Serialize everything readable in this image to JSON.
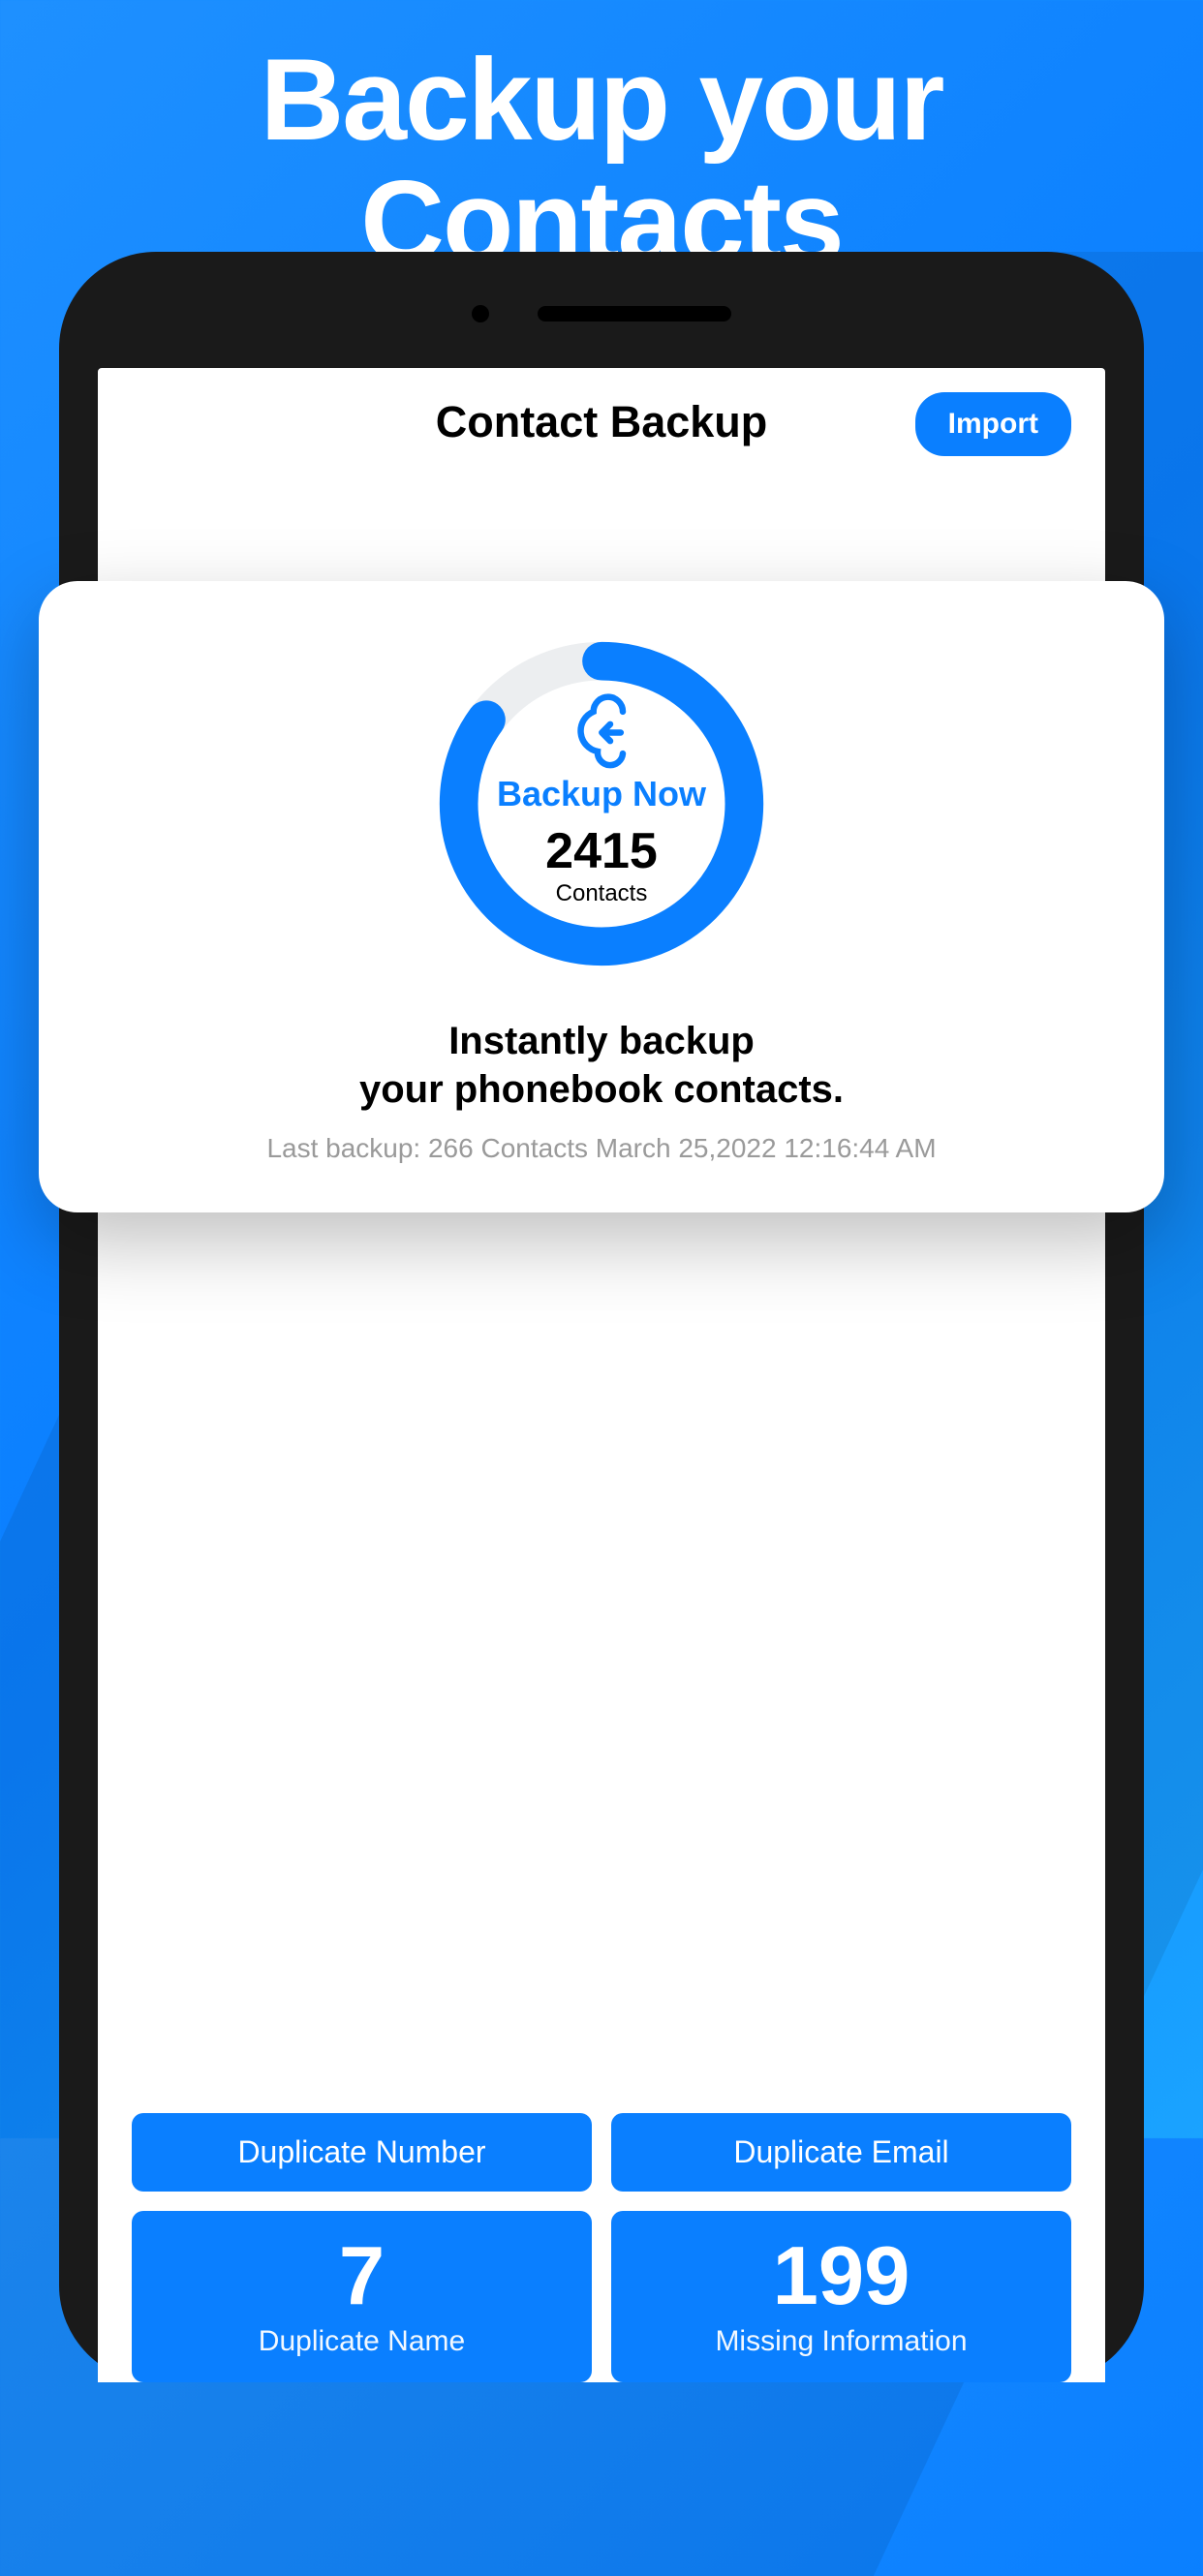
{
  "promo": {
    "title_line1": "Backup your",
    "title_line2": "Contacts"
  },
  "header": {
    "title": "Contact Backup",
    "import_label": "Import"
  },
  "backup_card": {
    "action_label": "Backup Now",
    "contact_count": "2415",
    "contact_unit": "Contacts",
    "desc_line1": "Instantly backup",
    "desc_line2": "your phonebook contacts.",
    "last_backup": "Last backup: 266 Contacts March 25,2022 12:16:44 AM",
    "progress_percent": 85
  },
  "tiles": [
    {
      "label_top": "Duplicate Number"
    },
    {
      "label_top": "Duplicate Email"
    },
    {
      "number": "7",
      "label_bottom": "Duplicate Name"
    },
    {
      "number": "199",
      "label_bottom": "Missing Information"
    }
  ],
  "colors": {
    "accent": "#0a7fff"
  }
}
